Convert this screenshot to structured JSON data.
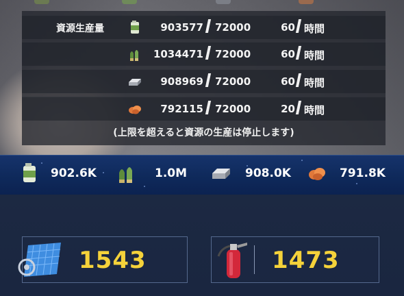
{
  "production": {
    "label": "資源生産量",
    "rows": [
      {
        "resource": "fuel",
        "icon": "fuel-can-icon",
        "current": "903577",
        "cap": "72000",
        "rate": "60",
        "unit": "時間"
      },
      {
        "resource": "ammo",
        "icon": "ammo-icon",
        "current": "1034471",
        "cap": "72000",
        "rate": "60",
        "unit": "時間"
      },
      {
        "resource": "steel",
        "icon": "steel-ingot-icon",
        "current": "908969",
        "cap": "72000",
        "rate": "60",
        "unit": "時間"
      },
      {
        "resource": "bauxite",
        "icon": "bauxite-icon",
        "current": "792115",
        "cap": "72000",
        "rate": "20",
        "unit": "時間"
      }
    ],
    "note": "(上限を超えると資源の生産は停止します)"
  },
  "resources": [
    {
      "name": "fuel",
      "icon": "fuel-can-icon",
      "value": "902.6K"
    },
    {
      "name": "ammo",
      "icon": "ammo-icon",
      "value": "1.0M"
    },
    {
      "name": "steel",
      "icon": "steel-ingot-icon",
      "value": "908.0K"
    },
    {
      "name": "bauxite",
      "icon": "bauxite-icon",
      "value": "791.8K"
    }
  ],
  "materials": {
    "blueprint": {
      "icon": "blueprint-icon",
      "value": "1543"
    },
    "repair": {
      "icon": "fire-extinguisher-icon",
      "value": "1473"
    }
  }
}
